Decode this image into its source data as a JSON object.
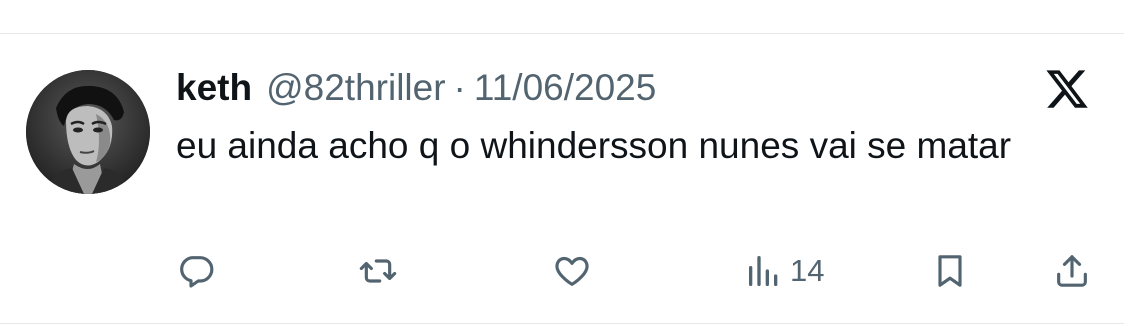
{
  "tweet": {
    "author": {
      "display_name": "keth",
      "handle": "@82thriller",
      "avatar": "grayscale-portrait-photo"
    },
    "separator": "·",
    "date": "11/06/2025",
    "text": "eu ainda acho q o whindersson nunes vai se matar",
    "platform_logo": "x-logo-icon",
    "actions": {
      "reply": {
        "icon": "reply-icon",
        "count": ""
      },
      "retweet": {
        "icon": "retweet-icon",
        "count": ""
      },
      "like": {
        "icon": "heart-icon",
        "count": ""
      },
      "views": {
        "icon": "views-bar-chart-icon",
        "count": "14"
      },
      "bookmark": {
        "icon": "bookmark-icon",
        "count": ""
      },
      "share": {
        "icon": "share-icon",
        "count": ""
      }
    }
  },
  "colors": {
    "text_primary": "#0f1419",
    "text_secondary": "#536471",
    "divider": "#e6e9ec",
    "background": "#ffffff"
  }
}
